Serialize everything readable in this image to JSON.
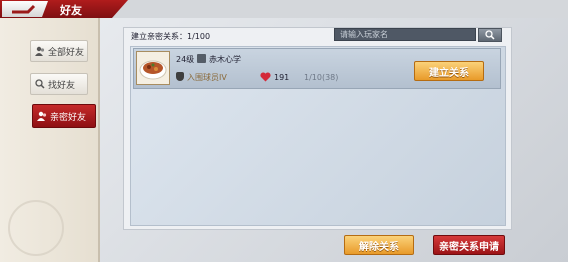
{
  "header": {
    "title": "好友",
    "back_icon": "back-arrow-icon"
  },
  "sidebar": {
    "items": [
      {
        "label": "全部好友",
        "icon": "group-icon",
        "active": false
      },
      {
        "label": "找好友",
        "icon": "search-icon",
        "active": false
      },
      {
        "label": "亲密好友",
        "icon": "group-icon",
        "active": true
      }
    ]
  },
  "main": {
    "count_label": "建立亲密关系：1/100",
    "search": {
      "placeholder": "请输入玩家名"
    },
    "friends": [
      {
        "level": "24级",
        "name": "赤木心学",
        "rank": "入围球员IV",
        "hearts": "191",
        "ratio": "1/10(38)",
        "action_label": "建立关系"
      }
    ]
  },
  "footer": {
    "remove_label": "解除关系",
    "request_label": "亲密关系申请"
  },
  "colors": {
    "accent_red": "#9c1417",
    "accent_gold": "#e89a2a",
    "sidebar_bg": "#f1ece2"
  }
}
